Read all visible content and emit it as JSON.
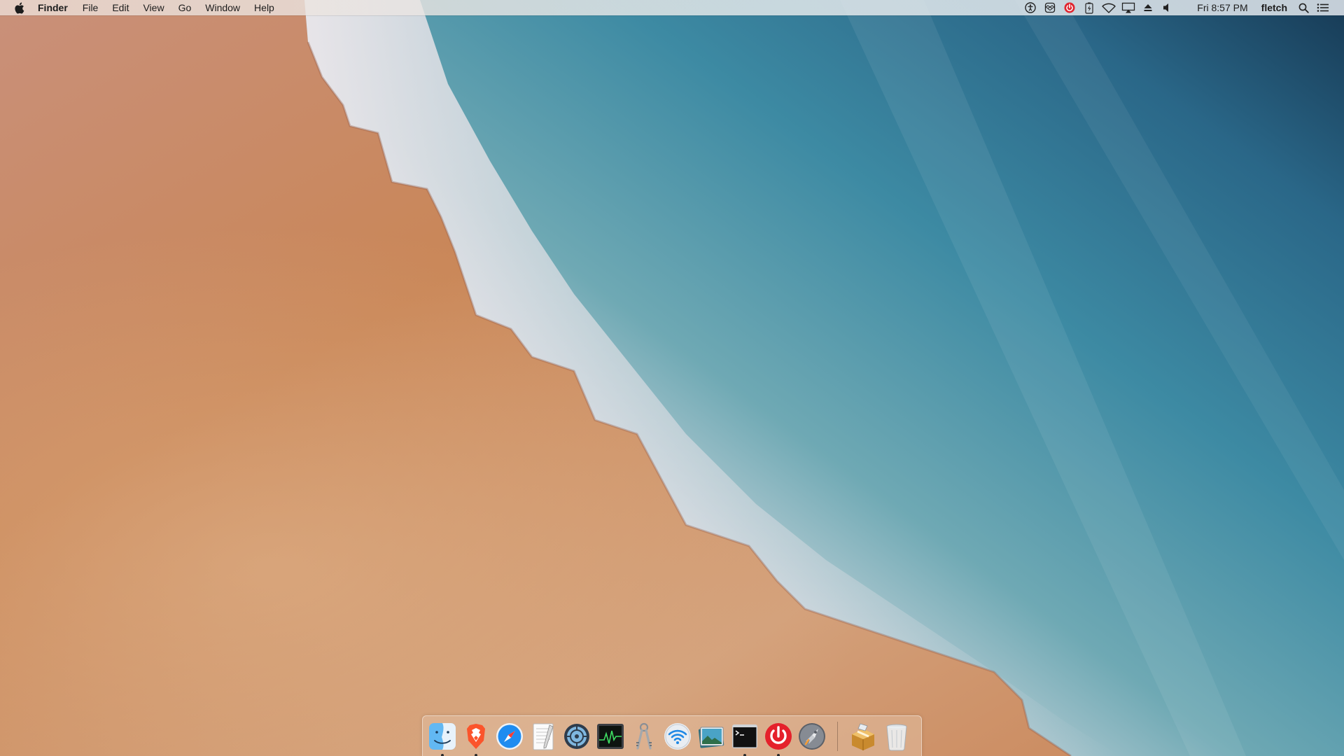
{
  "menubar": {
    "app_name": "Finder",
    "menus": [
      "File",
      "Edit",
      "View",
      "Go",
      "Window",
      "Help"
    ],
    "status_icons": [
      "accessibility-icon",
      "dropbox-icon",
      "power-app-icon",
      "battery-charging-icon",
      "wifi-icon",
      "airplay-icon",
      "eject-icon",
      "volume-icon"
    ],
    "clock": "Fri 8:57 PM",
    "user": "fletch",
    "spotlight_icon": "spotlight-search-icon",
    "notification_icon": "notification-center-icon"
  },
  "dock": {
    "apps": [
      {
        "icon": "finder-icon",
        "running": true
      },
      {
        "icon": "brave-browser-icon",
        "running": true
      },
      {
        "icon": "safari-icon",
        "running": false
      },
      {
        "icon": "textedit-icon",
        "running": false
      },
      {
        "icon": "disk-utility-icon",
        "running": false
      },
      {
        "icon": "activity-monitor-icon",
        "running": false
      },
      {
        "icon": "keychain-access-icon",
        "running": false
      },
      {
        "icon": "wireless-diagnostics-icon",
        "running": false
      },
      {
        "icon": "preview-icon",
        "running": false
      },
      {
        "icon": "terminal-icon",
        "running": true
      },
      {
        "icon": "power-app-icon",
        "running": true
      },
      {
        "icon": "launchpad-icon",
        "running": false
      }
    ],
    "others": [
      {
        "icon": "installer-package-icon",
        "running": false
      },
      {
        "icon": "trash-icon",
        "running": false
      }
    ]
  },
  "colors": {
    "sand": "#c98a5c",
    "foam": "#f1e4e6",
    "ocean_deep": "#1d4a68",
    "ocean_mid": "#3f8ca2",
    "menubar_text": "#1c1c1c"
  }
}
